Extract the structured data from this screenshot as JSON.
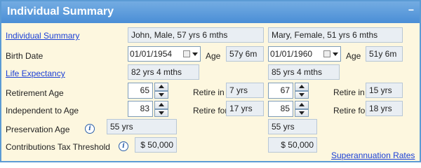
{
  "panel": {
    "title": "Individual Summary",
    "collapse_icon": "−"
  },
  "labels": {
    "individual_summary": "Individual Summary",
    "birth_date": "Birth Date",
    "life_expectancy": "Life Expectancy",
    "retirement_age": "Retirement Age",
    "independent_to_age": "Independent to Age",
    "preservation_age": "Preservation Age",
    "contributions_tax_threshold": "Contributions Tax Threshold",
    "age": "Age",
    "retire_in": "Retire in",
    "retire_for": "Retire for",
    "superannuation_rates": "Superannuation Rates"
  },
  "person1": {
    "summary": "John, Male, 57 yrs 6 mths",
    "birth_date": "01/01/1954",
    "age": "57y 6m",
    "life_expectancy": "82 yrs 4 mths",
    "retirement_age": "65",
    "retire_in": "7 yrs",
    "independent_to_age": "83",
    "retire_for": "17 yrs",
    "preservation_age": "55 yrs",
    "tax_threshold": "$ 50,000"
  },
  "person2": {
    "summary": "Mary, Female, 51 yrs 6 mths",
    "birth_date": "01/01/1960",
    "age": "51y 6m",
    "life_expectancy": "85 yrs 4 mths",
    "retirement_age": "67",
    "retire_in": "15 yrs",
    "independent_to_age": "85",
    "retire_for": "18 yrs",
    "preservation_age": "55 yrs",
    "tax_threshold": "$ 50,000"
  },
  "icons": {
    "info": "i"
  }
}
